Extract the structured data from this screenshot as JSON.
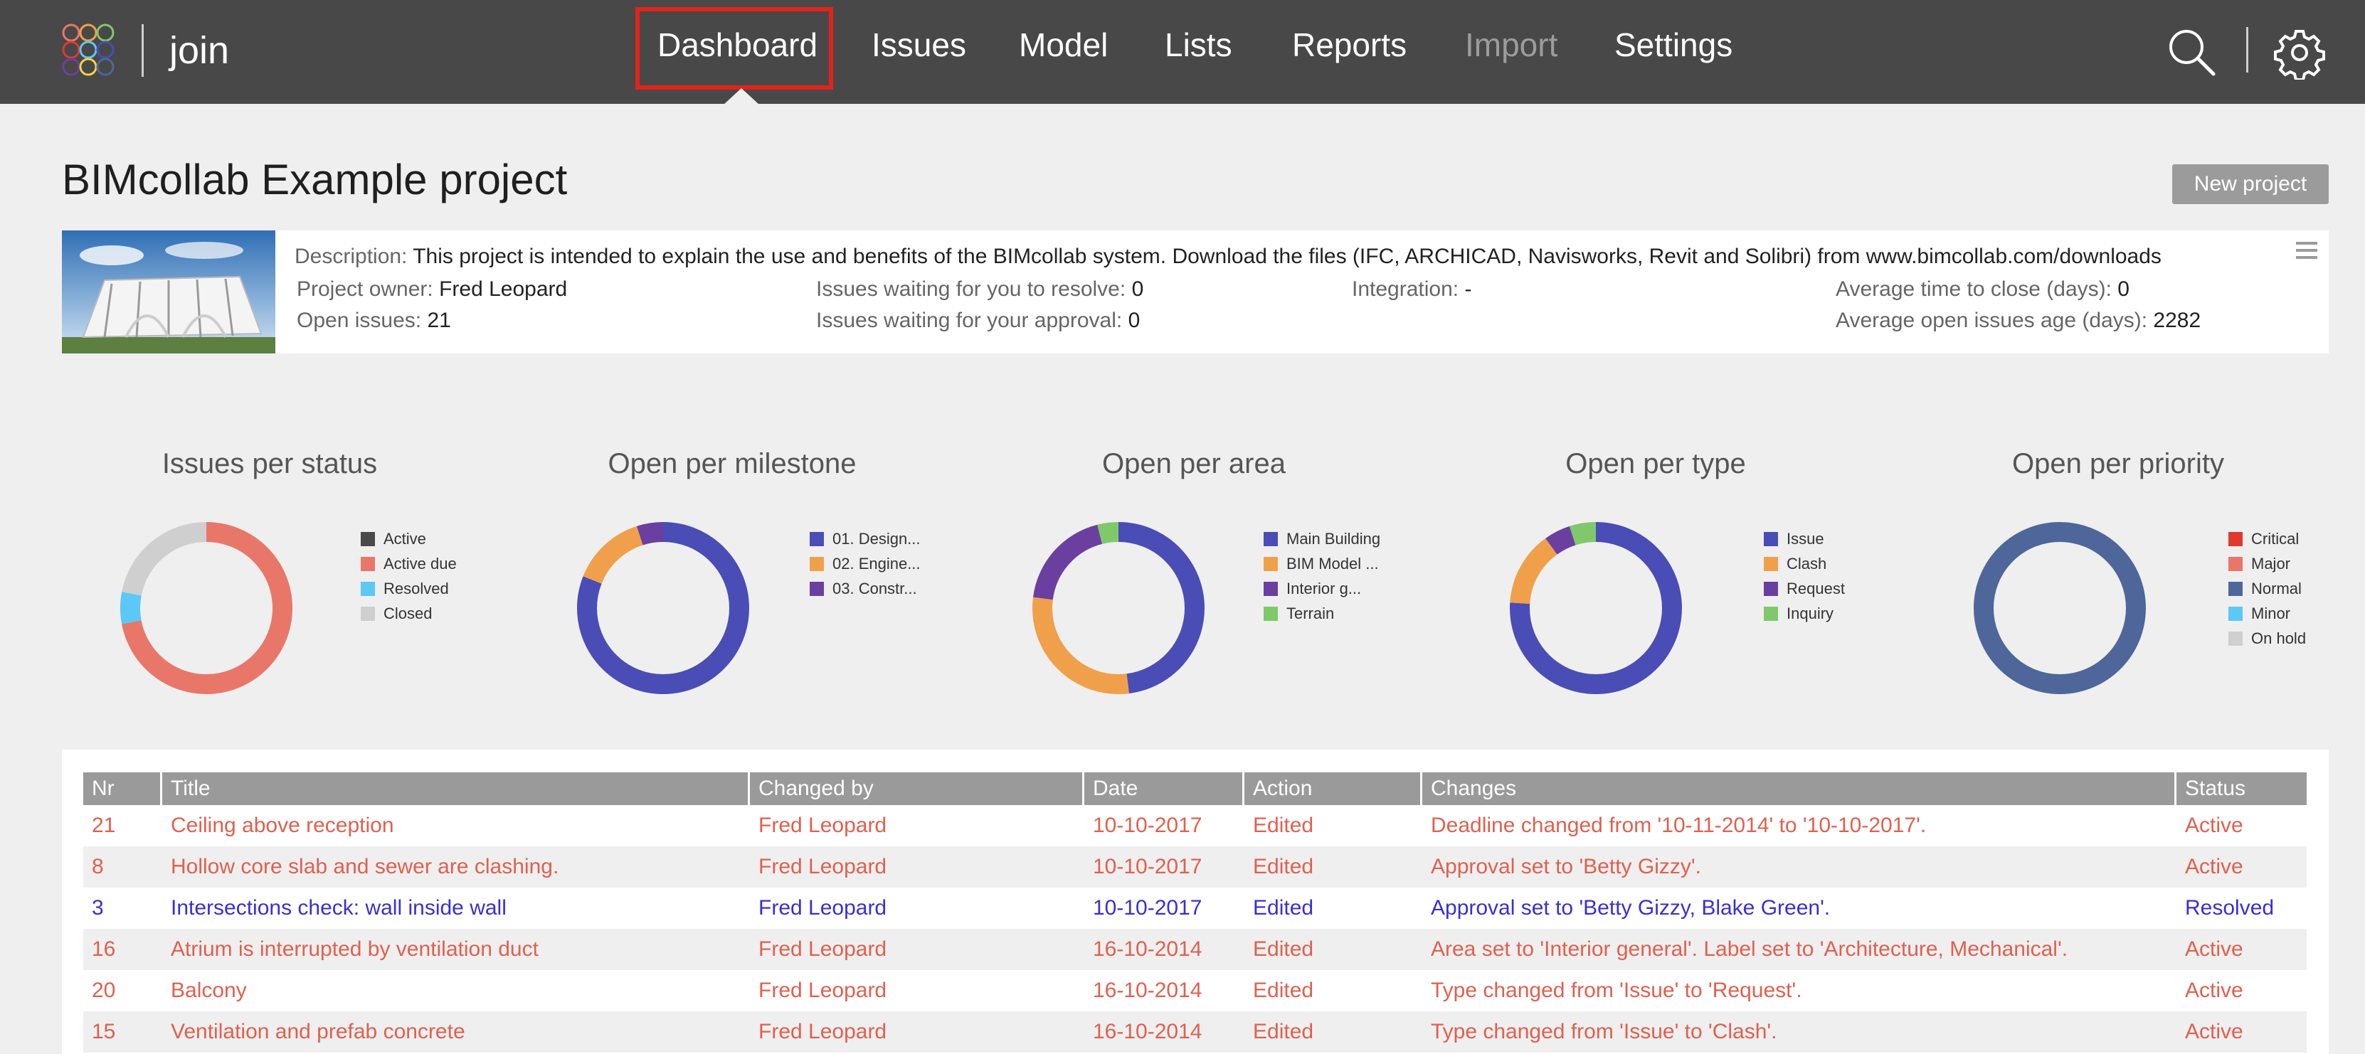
{
  "topbar": {
    "app_name": "join",
    "nav": [
      {
        "label": "Dashboard"
      },
      {
        "label": "Issues"
      },
      {
        "label": "Model"
      },
      {
        "label": "Lists"
      },
      {
        "label": "Reports"
      },
      {
        "label": "Import"
      },
      {
        "label": "Settings"
      }
    ],
    "active_nav": "Dashboard",
    "disabled_nav": "Import",
    "icons": [
      "search-icon",
      "gear-icon"
    ]
  },
  "project": {
    "title": "BIMcollab Example project",
    "new_project_label": "New project",
    "description_label": "Description:",
    "description": "This project is intended to explain the use and benefits of the BIMcollab system. Download the files (IFC, ARCHICAD, Navisworks, Revit and Solibri) from www.bimcollab.com/downloads",
    "owner_label": "Project owner:",
    "owner": "Fred Leopard",
    "open_issues_label": "Open issues:",
    "open_issues": "21",
    "waiting_resolve_label": "Issues waiting for you to resolve:",
    "waiting_resolve": "0",
    "waiting_approval_label": "Issues waiting for your approval:",
    "waiting_approval": "0",
    "integration_label": "Integration:",
    "integration": "-",
    "avg_close_label": "Average time to close (days):",
    "avg_close": "0",
    "avg_age_label": "Average open issues age (days):",
    "avg_age": "2282"
  },
  "charts": [
    {
      "title": "Issues per status",
      "legend": [
        {
          "label": "Active",
          "color": "#4a4a4a",
          "value": 0
        },
        {
          "label": "Active due",
          "color": "#e8776a",
          "value": 72
        },
        {
          "label": "Resolved",
          "color": "#5bc8f5",
          "value": 6
        },
        {
          "label": "Closed",
          "color": "#cfcfcf",
          "value": 22
        }
      ]
    },
    {
      "title": "Open per milestone",
      "legend": [
        {
          "label": "01. Design...",
          "color": "#4a4db5",
          "value": 81
        },
        {
          "label": "02. Engine...",
          "color": "#f0a04b",
          "value": 14
        },
        {
          "label": "03. Constr...",
          "color": "#6b3fa0",
          "value": 5
        }
      ]
    },
    {
      "title": "Open per area",
      "legend": [
        {
          "label": "Main Building",
          "color": "#4a4db5",
          "value": 48
        },
        {
          "label": "BIM Model ...",
          "color": "#f0a04b",
          "value": 29
        },
        {
          "label": "Interior g...",
          "color": "#6b3fa0",
          "value": 19
        },
        {
          "label": "Terrain",
          "color": "#7fc96b",
          "value": 4
        }
      ]
    },
    {
      "title": "Open per type",
      "legend": [
        {
          "label": "Issue",
          "color": "#4a4db5",
          "value": 76
        },
        {
          "label": "Clash",
          "color": "#f0a04b",
          "value": 14
        },
        {
          "label": "Request",
          "color": "#6b3fa0",
          "value": 5
        },
        {
          "label": "Inquiry",
          "color": "#7fc96b",
          "value": 5
        }
      ]
    },
    {
      "title": "Open per priority",
      "legend": [
        {
          "label": "Critical",
          "color": "#e03a2f",
          "value": 0
        },
        {
          "label": "Major",
          "color": "#e8776a",
          "value": 0
        },
        {
          "label": "Normal",
          "color": "#4e6699",
          "value": 100
        },
        {
          "label": "Minor",
          "color": "#5bc8f5",
          "value": 0
        },
        {
          "label": "On hold",
          "color": "#cfcfcf",
          "value": 0
        }
      ]
    }
  ],
  "table": {
    "headers": [
      "Nr",
      "Title",
      "Changed by",
      "Date",
      "Action",
      "Changes",
      "Status"
    ],
    "rows": [
      {
        "nr": "21",
        "title": "Ceiling above reception",
        "changed_by": "Fred Leopard",
        "date": "10-10-2017",
        "action": "Edited",
        "changes": "Deadline changed from '10-11-2014' to '10-10-2017'.",
        "status": "Active",
        "color": "#e0604f"
      },
      {
        "nr": "8",
        "title": "Hollow core slab and sewer are clashing.",
        "changed_by": "Fred Leopard",
        "date": "10-10-2017",
        "action": "Edited",
        "changes": "Approval set to 'Betty Gizzy'.",
        "status": "Active",
        "color": "#e0604f"
      },
      {
        "nr": "3",
        "title": "Intersections check: wall inside wall",
        "changed_by": "Fred Leopard",
        "date": "10-10-2017",
        "action": "Edited",
        "changes": "Approval set to 'Betty Gizzy, Blake Green'.",
        "status": "Resolved",
        "color": "#3b2fd1"
      },
      {
        "nr": "16",
        "title": "Atrium is interrupted by ventilation duct",
        "changed_by": "Fred Leopard",
        "date": "16-10-2014",
        "action": "Edited",
        "changes": "Area set to 'Interior general'. Label set to 'Architecture, Mechanical'.",
        "status": "Active",
        "color": "#e0604f"
      },
      {
        "nr": "20",
        "title": "Balcony",
        "changed_by": "Fred Leopard",
        "date": "16-10-2014",
        "action": "Edited",
        "changes": "Type changed from 'Issue' to 'Request'.",
        "status": "Active",
        "color": "#e0604f"
      },
      {
        "nr": "15",
        "title": "Ventilation and prefab concrete",
        "changed_by": "Fred Leopard",
        "date": "16-10-2014",
        "action": "Edited",
        "changes": "Type changed from 'Issue' to 'Clash'.",
        "status": "Active",
        "color": "#e0604f"
      }
    ]
  }
}
